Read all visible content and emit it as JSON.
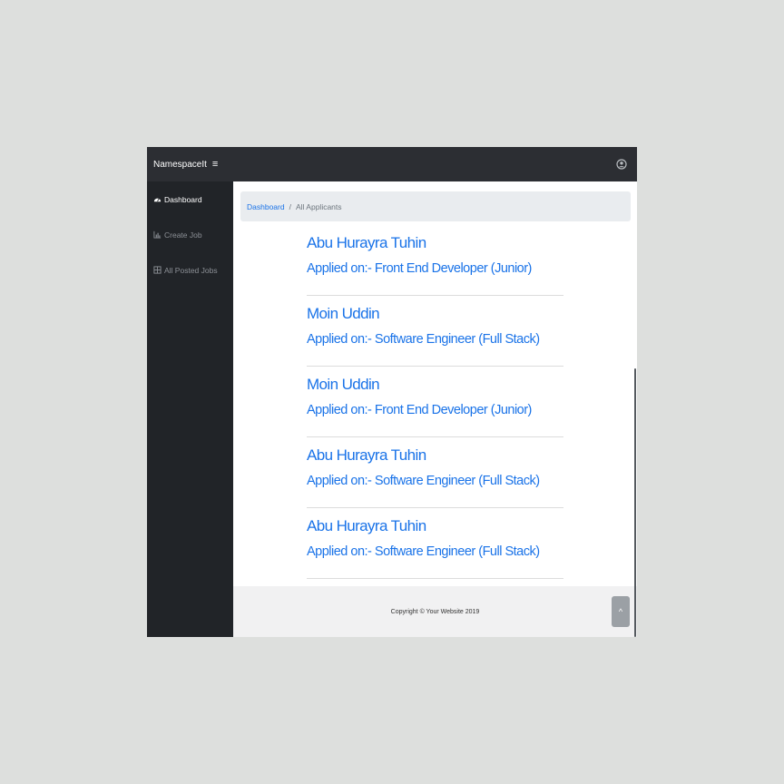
{
  "topbar": {
    "brand": "NamespaceIt",
    "toggle_glyph": "≡",
    "user_icon": "user-circle-icon"
  },
  "sidebar": {
    "items": [
      {
        "label": "Dashboard",
        "icon": "dashboard-icon",
        "active": true
      },
      {
        "label": "Create Job",
        "icon": "chart-icon",
        "active": false
      },
      {
        "label": "All Posted Jobs",
        "icon": "table-icon",
        "active": false
      }
    ]
  },
  "breadcrumb": {
    "home": "Dashboard",
    "separator": "/",
    "current": "All Applicants"
  },
  "applicants": [
    {
      "name": "Abu Hurayra Tuhin",
      "applied": "Applied on:- Front End Developer (Junior)"
    },
    {
      "name": "Moin Uddin",
      "applied": "Applied on:- Software Engineer (Full Stack)"
    },
    {
      "name": "Moin Uddin",
      "applied": "Applied on:- Front End Developer (Junior)"
    },
    {
      "name": "Abu Hurayra Tuhin",
      "applied": "Applied on:- Software Engineer (Full Stack)"
    },
    {
      "name": "Abu Hurayra Tuhin",
      "applied": "Applied on:- Software Engineer (Full Stack)"
    }
  ],
  "footer": {
    "copyright": "Copyright © Your Website 2019"
  },
  "scroll_top": {
    "glyph": "^"
  },
  "colors": {
    "link": "#1a73e8",
    "topbar": "#2c2e33",
    "sidebar": "#212428"
  }
}
